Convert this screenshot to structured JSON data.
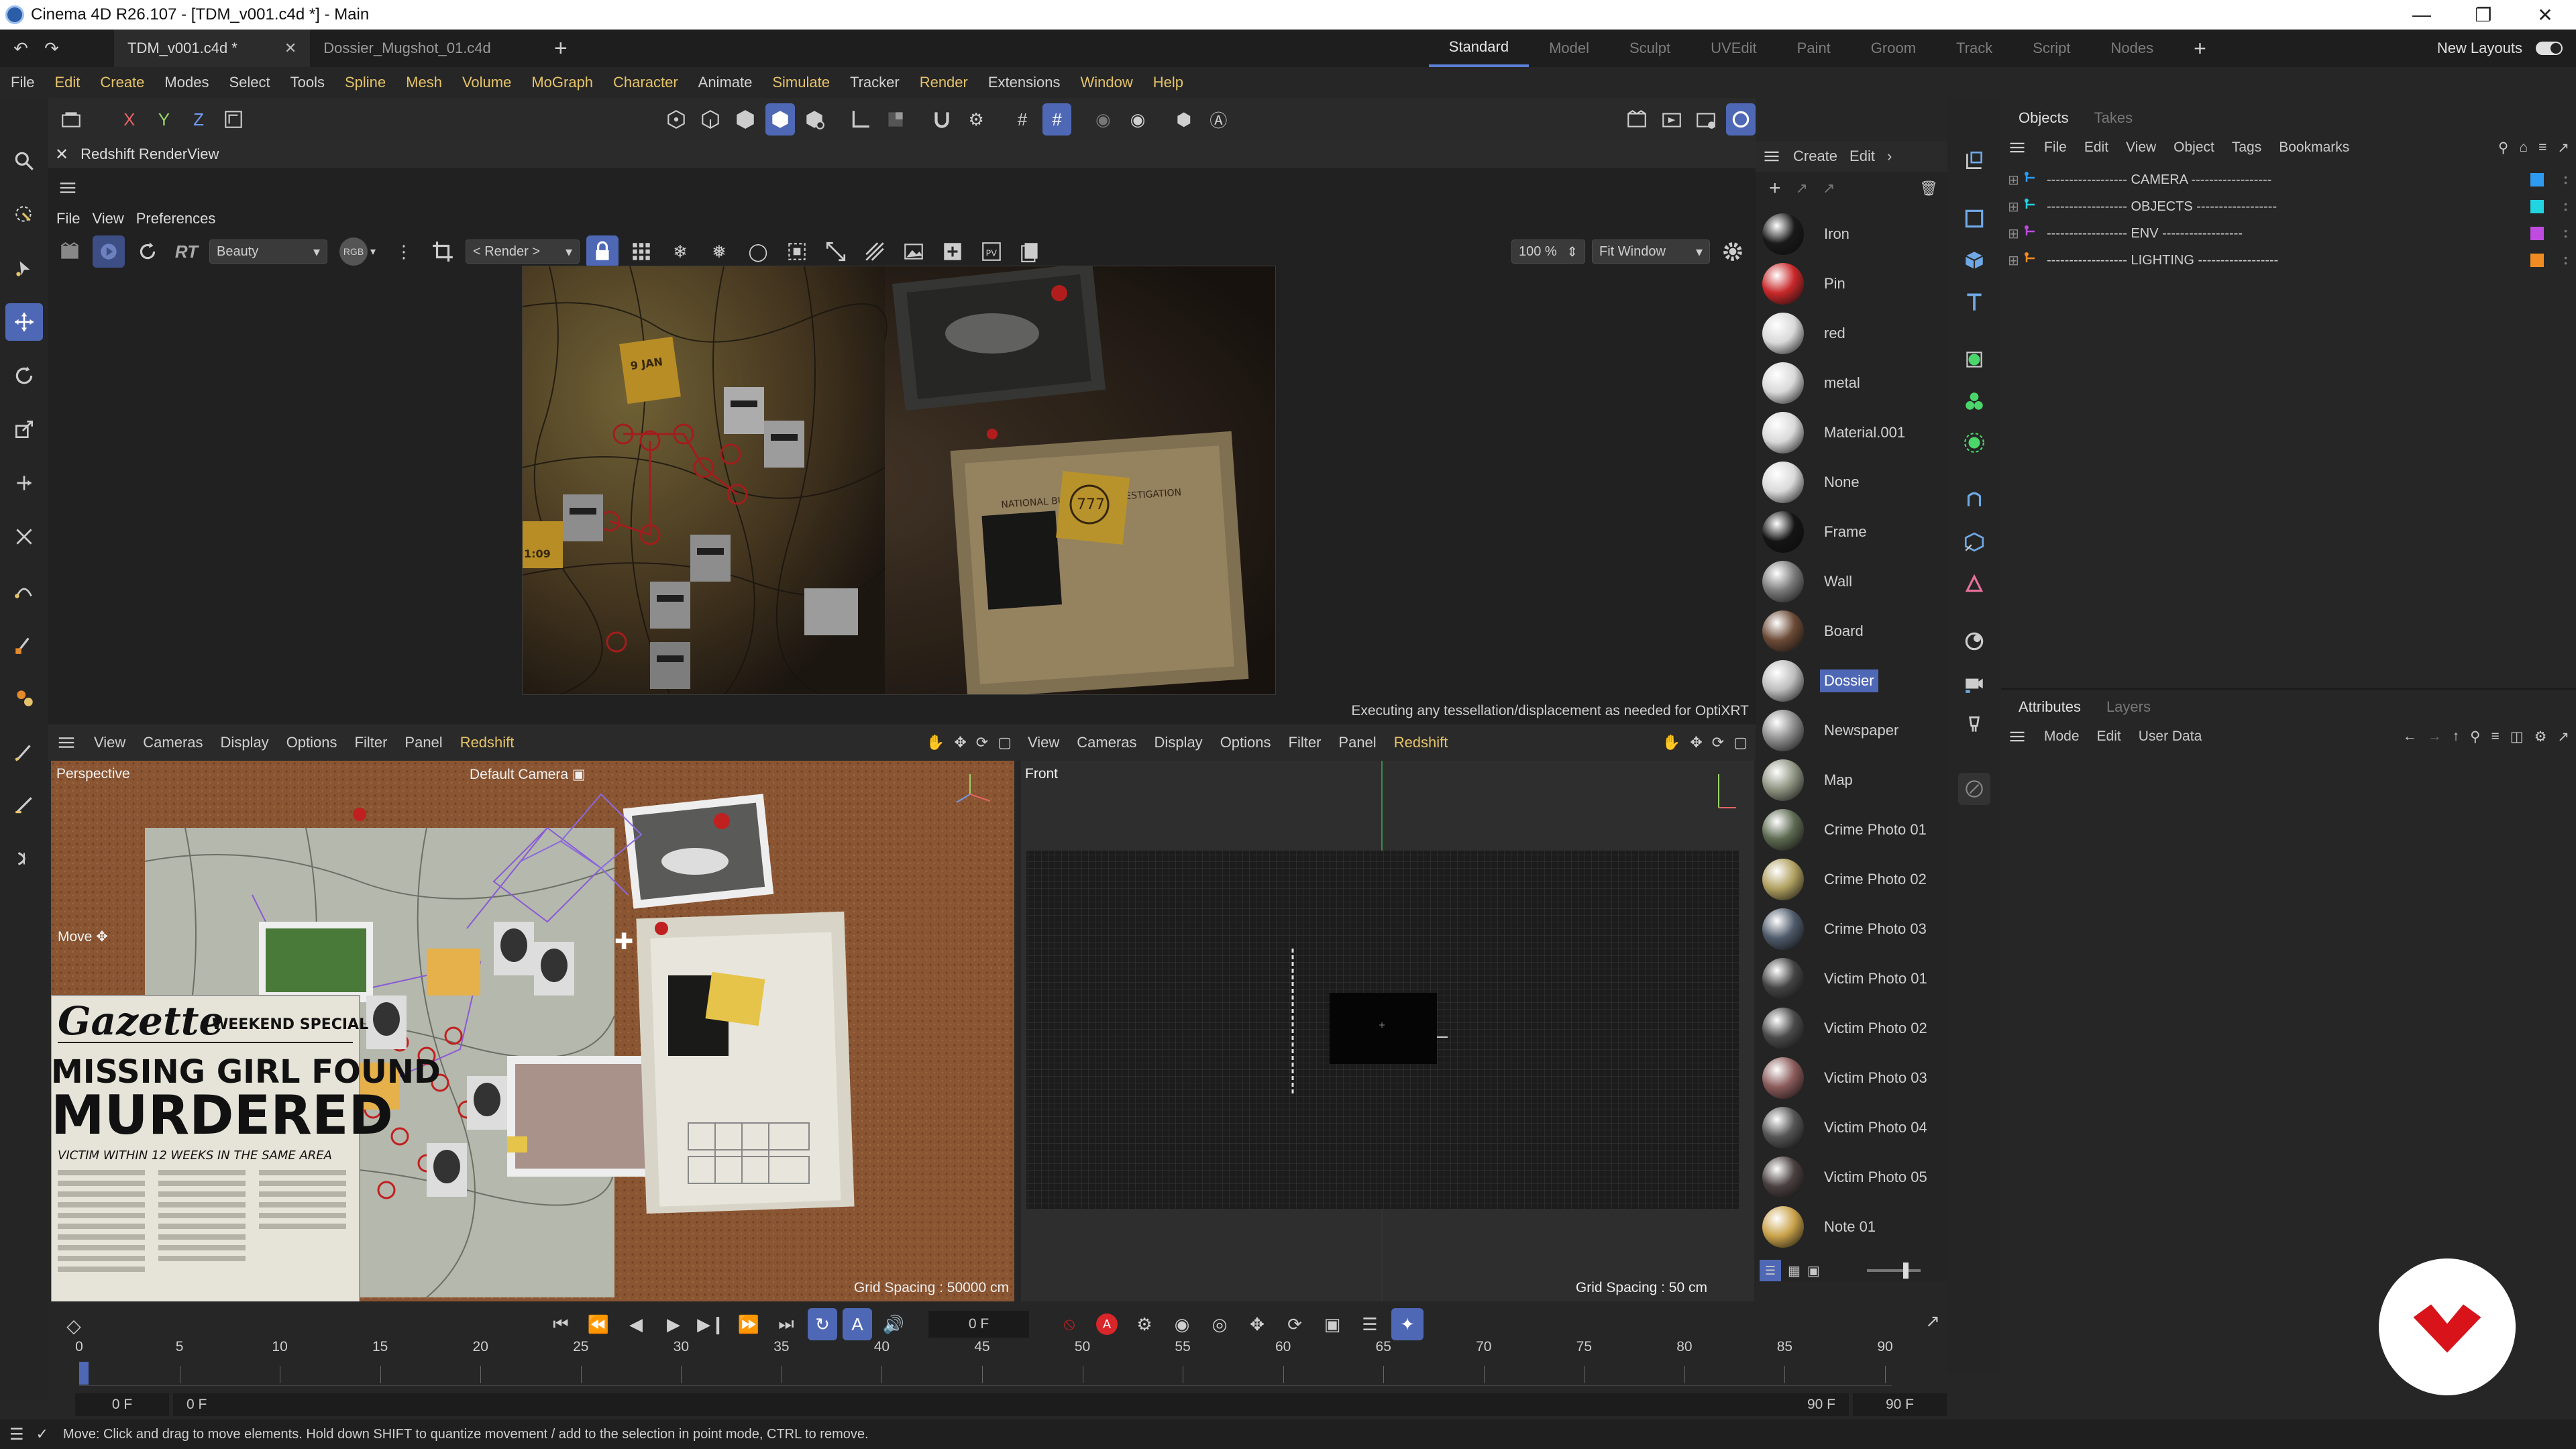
{
  "window": {
    "title": "Cinema 4D R26.107 - [TDM_v001.c4d *] - Main"
  },
  "doc_tabs": [
    {
      "label": "TDM_v001.c4d *",
      "active": true
    },
    {
      "label": "Dossier_Mugshot_01.c4d",
      "active": false
    }
  ],
  "layouts": {
    "tabs": [
      "Standard",
      "Model",
      "Sculpt",
      "UVEdit",
      "Paint",
      "Groom",
      "Track",
      "Script",
      "Nodes"
    ],
    "active": "Standard",
    "new_layouts_label": "New Layouts"
  },
  "menu": [
    "File",
    "Edit",
    "Create",
    "Modes",
    "Select",
    "Tools",
    "Spline",
    "Mesh",
    "Volume",
    "MoGraph",
    "Character",
    "Animate",
    "Simulate",
    "Tracker",
    "Render",
    "Extensions",
    "Window",
    "Help"
  ],
  "toolbar": {
    "axis_x": "X",
    "axis_y": "Y",
    "axis_z": "Z"
  },
  "renderview": {
    "title": "Redshift RenderView",
    "menu": [
      "File",
      "View",
      "Preferences"
    ],
    "rt_label": "RT",
    "aov_value": "Beauty",
    "rgb_label": "RGB",
    "render_dropdown": "< Render >",
    "zoom_value": "100 %",
    "fit_value": "Fit Window",
    "status": "Executing any tessellation/displacement as needed for OptiXRT",
    "scene_labels": {
      "jan_note": "9 JAN",
      "note_777": "777",
      "time_note": "1:09",
      "bureau": "NATIONAL BUREAU OF INVESTIGATION"
    }
  },
  "materials": {
    "header": [
      "Create",
      "Edit"
    ],
    "items": [
      {
        "name": "Iron",
        "color": "#1a1a1a"
      },
      {
        "name": "Pin",
        "color": "#c8282a"
      },
      {
        "name": "red",
        "color": "#d9d9d9"
      },
      {
        "name": "metal",
        "color": "#d9d9d9"
      },
      {
        "name": "Material.001",
        "color": "#d9d9d9"
      },
      {
        "name": "None",
        "color": "#d9d9d9"
      },
      {
        "name": "Frame",
        "color": "#151515"
      },
      {
        "name": "Wall",
        "color": "#7a7a7a"
      },
      {
        "name": "Board",
        "color": "#6b4a36"
      },
      {
        "name": "Dossier",
        "color": "#bdbdbd",
        "selected": true
      },
      {
        "name": "Newspaper",
        "color": "#8b8b8b"
      },
      {
        "name": "Map",
        "color": "#8f9482"
      },
      {
        "name": "Crime Photo 01",
        "color": "#5e6a52"
      },
      {
        "name": "Crime Photo 02",
        "color": "#b0a060"
      },
      {
        "name": "Crime Photo 03",
        "color": "#4e5a6a"
      },
      {
        "name": "Victim Photo 01",
        "color": "#444444"
      },
      {
        "name": "Victim Photo 02",
        "color": "#4a4a4a"
      },
      {
        "name": "Victim Photo 03",
        "color": "#8a5a5a"
      },
      {
        "name": "Victim Photo 04",
        "color": "#555555"
      },
      {
        "name": "Victim Photo 05",
        "color": "#4a4040"
      },
      {
        "name": "Note 01",
        "color": "#c9a24a"
      }
    ]
  },
  "objects": {
    "tabs": [
      "Objects",
      "Takes"
    ],
    "menu": [
      "File",
      "Edit",
      "View",
      "Object",
      "Tags",
      "Bookmarks"
    ],
    "items": [
      {
        "label": "------------------ CAMERA ------------------",
        "color": "#2e9bf0"
      },
      {
        "label": "------------------ OBJECTS ------------------",
        "color": "#22d3e0"
      },
      {
        "label": "------------------ ENV ------------------",
        "color": "#c04be0"
      },
      {
        "label": "------------------ LIGHTING ------------------",
        "color": "#f08c22"
      }
    ]
  },
  "attributes": {
    "tabs": [
      "Attributes",
      "Layers"
    ],
    "menu": [
      "Mode",
      "Edit",
      "User Data"
    ]
  },
  "viewport_left": {
    "menu": [
      "View",
      "Cameras",
      "Display",
      "Options",
      "Filter",
      "Panel",
      "Redshift"
    ],
    "name": "Perspective",
    "camera": "Default Camera",
    "tool": "Move",
    "grid_spacing": "Grid Spacing : 50000 cm",
    "newspaper": {
      "masthead": "Gazette",
      "special": "WEEKEND SPECIAL",
      "headline1": "MISSING GIRL FOUND",
      "headline2": "MURDERED",
      "sub": "VICTIM WITHIN 12 WEEKS IN THE SAME AREA"
    }
  },
  "viewport_right": {
    "menu": [
      "View",
      "Cameras",
      "Display",
      "Options",
      "Filter",
      "Panel",
      "Redshift"
    ],
    "name": "Front",
    "grid_spacing": "Grid Spacing : 50 cm"
  },
  "timeline": {
    "current_frame": "0 F",
    "ticks": [
      "0",
      "5",
      "10",
      "15",
      "20",
      "25",
      "30",
      "35",
      "40",
      "45",
      "50",
      "55",
      "60",
      "65",
      "70",
      "75",
      "80",
      "85",
      "90"
    ],
    "start": "0 F",
    "start2": "0 F",
    "end": "90 F",
    "end2": "90 F"
  },
  "status_bar": {
    "text": "Move: Click and drag to move elements. Hold down SHIFT to quantize movement / add to the selection in point mode, CTRL to remove."
  },
  "colors": {
    "accent": "#4f68b6",
    "menu_highlight": "#e5c36a",
    "redshift": "#e5c36a",
    "logo_red": "#d8141a"
  }
}
